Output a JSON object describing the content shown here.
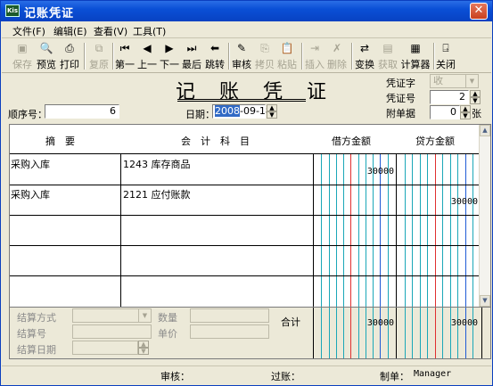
{
  "window": {
    "app_icon": "ic-app-icon",
    "title": "记账凭证",
    "close": "✕"
  },
  "menu": [
    {
      "label": "文件(F)"
    },
    {
      "label": "编辑(E)"
    },
    {
      "label": "查看(V)"
    },
    {
      "label": "工具(T)"
    }
  ],
  "toolbar": {
    "save": "保存",
    "preview": "预览",
    "print": "打印",
    "restore": "复原",
    "first": "第一",
    "prev": "上一",
    "next": "下一",
    "last": "最后",
    "jump": "跳转",
    "audit": "审核",
    "copy": "拷贝",
    "paste": "粘贴",
    "insert": "插入",
    "delete": "删除",
    "exchange": "变换",
    "fetch": "获取",
    "calculator": "计算器",
    "close": "关闭"
  },
  "header": {
    "title": "记 账 凭 证",
    "seq_label": "顺序号：",
    "seq_value": "6",
    "date_label": "日期：",
    "date_year": "2008",
    "date_rest": "-09-18",
    "voucher_word_label": "凭证字",
    "voucher_word_value": "收",
    "voucher_no_label": "凭证号",
    "voucher_no_value": "2",
    "attach_label": "附单据",
    "attach_value": "0",
    "attach_unit": "张"
  },
  "grid": {
    "col_summary": "摘　要",
    "col_account": "会　计　科　目",
    "col_debit": "借方金额",
    "col_credit": "贷方金额",
    "rows": [
      {
        "summary": "采购入库",
        "account": "1243 库存商品",
        "debit": "30000",
        "credit": ""
      },
      {
        "summary": "采购入库",
        "account": "2121 应付账款",
        "debit": "",
        "credit": "30000"
      },
      {
        "summary": "",
        "account": "",
        "debit": "",
        "credit": ""
      },
      {
        "summary": "",
        "account": "",
        "debit": "",
        "credit": ""
      },
      {
        "summary": "",
        "account": "",
        "debit": "",
        "credit": ""
      }
    ]
  },
  "bottom": {
    "settle_method": "结算方式",
    "quantity": "数量",
    "settle_no": "结算号",
    "unit_price": "单价",
    "settle_date": "结算日期",
    "total_label": "合计",
    "total_debit": "30000",
    "total_credit": "30000"
  },
  "status": {
    "audit": "审核：",
    "post": "过账：",
    "maker_label": "制单：",
    "maker_value": "Manager"
  },
  "colors": {
    "digit_line": "#1aa7b8",
    "unit_line": "#1f5bd6",
    "thousand_line": "#e03030"
  }
}
